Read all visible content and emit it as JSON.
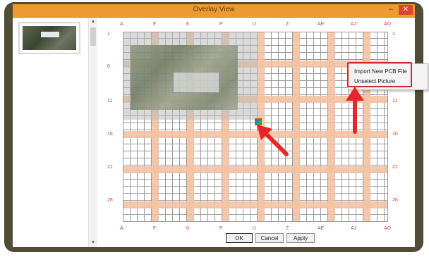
{
  "window": {
    "title": "Overlay View",
    "minimize": "–",
    "close": "✕"
  },
  "columns": [
    "A",
    "F",
    "K",
    "P",
    "U",
    "Z",
    "AE",
    "AJ",
    "AO"
  ],
  "rows": [
    "1",
    "6",
    "11",
    "16",
    "21",
    "26"
  ],
  "context_menu": {
    "items": [
      "Import New PCB File",
      "Unselect Picture"
    ]
  },
  "buttons": {
    "ok": "OK",
    "cancel": "Cancel",
    "apply": "Apply"
  },
  "colors": {
    "titlebar": "#ec9b30",
    "grid_band": "#f3c2a3",
    "highlight": "#d22a2a",
    "label": "#c8434c"
  },
  "icons": [
    "minimize-icon",
    "close-icon",
    "scroll-up-icon",
    "scroll-down-icon",
    "red-arrow-icon",
    "anchor-handle-icon"
  ]
}
